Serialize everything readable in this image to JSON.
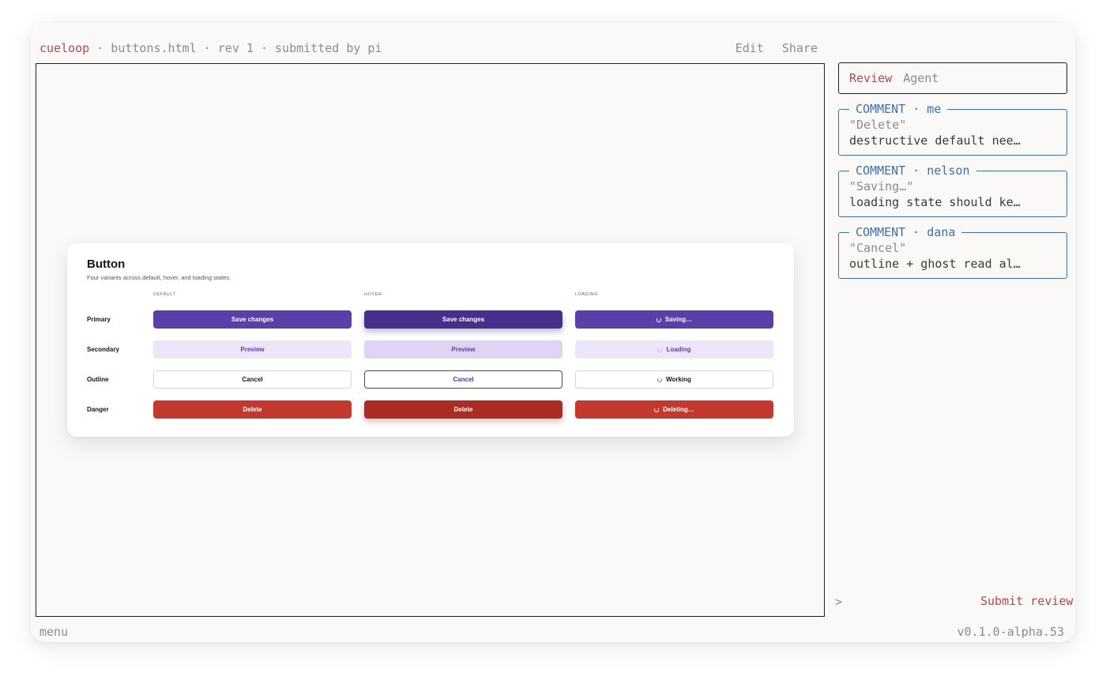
{
  "topbar": {
    "brand": "cueloop",
    "crumb": " · buttons.html · rev 1 · submitted by pi",
    "edit": "Edit",
    "share": "Share"
  },
  "card": {
    "title": "Button",
    "subtitle": "Four variants across default, hover, and loading states.",
    "columns": [
      "DEFAULT",
      "HOVER",
      "LOADING"
    ],
    "rows": [
      {
        "label": "Primary",
        "default": "Save changes",
        "hover": "Save changes",
        "loading": "Saving…"
      },
      {
        "label": "Secondary",
        "default": "Preview",
        "hover": "Preview",
        "loading": "Loading"
      },
      {
        "label": "Outline",
        "default": "Cancel",
        "hover": "Cancel",
        "loading": "Working"
      },
      {
        "label": "Danger",
        "default": "Delete",
        "hover": "Delete",
        "loading": "Deleting…"
      }
    ]
  },
  "review": {
    "tab_review": "Review",
    "tab_agent": "Agent",
    "comments": [
      {
        "header": "COMMENT · me",
        "quote": "\"Delete\"",
        "text": "destructive default nee…"
      },
      {
        "header": "COMMENT · nelson",
        "quote": "\"Saving…\"",
        "text": "loading state should ke…"
      },
      {
        "header": "COMMENT · dana",
        "quote": "\"Cancel\"",
        "text": "outline + ghost read al…"
      }
    ],
    "prompt": ">",
    "submit": "Submit review"
  },
  "footer": {
    "menu": "menu",
    "version": "v0.1.0-alpha.53"
  },
  "colors": {
    "accent": "#b5484e",
    "comment": "#3f6fa8",
    "primary": "#5b3fa8",
    "danger": "#c3392e"
  }
}
